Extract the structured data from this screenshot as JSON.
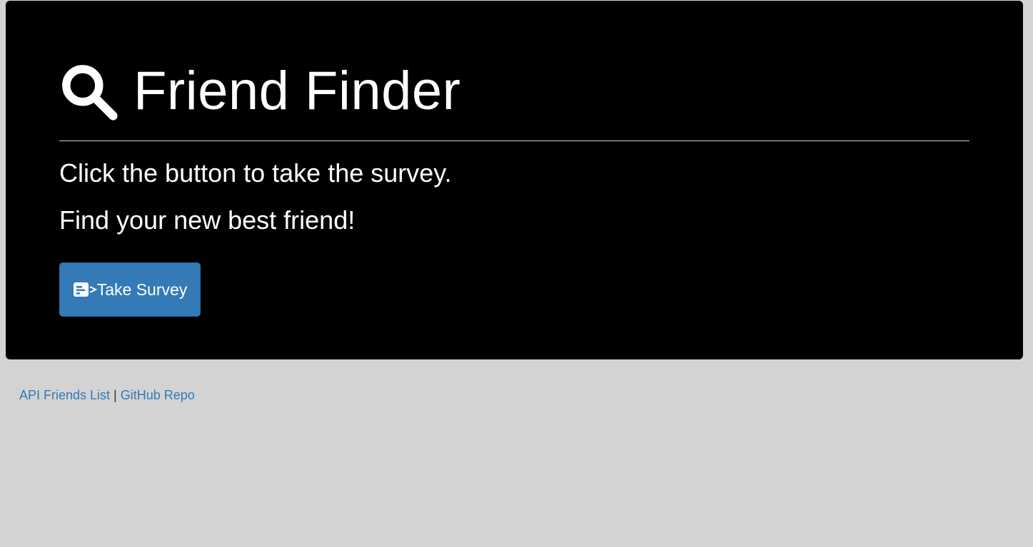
{
  "header": {
    "icon": "search-icon",
    "title": "Friend Finder"
  },
  "intro": {
    "line1": "Click the button to take the survey.",
    "line2": "Find your new best friend!"
  },
  "survey_button": {
    "icon": "survey-form-icon",
    "label": "Take Survey"
  },
  "footer": {
    "links": [
      {
        "label": "API Friends List"
      },
      {
        "label": "GitHub Repo"
      }
    ],
    "separator": "|"
  },
  "colors": {
    "page_background": "#d3d3d3",
    "jumbotron_background": "#000000",
    "button_primary": "#337ab7",
    "link": "#337ab7"
  }
}
